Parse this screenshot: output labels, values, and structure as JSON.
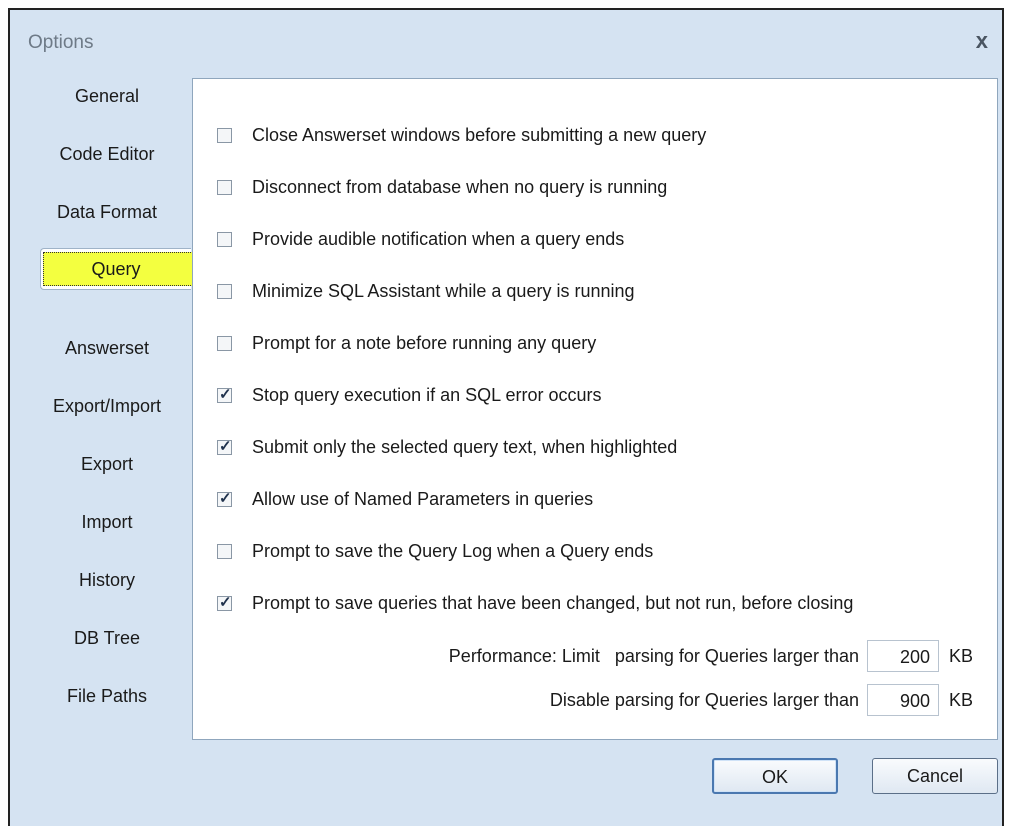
{
  "window": {
    "title": "Options",
    "close_glyph": "x"
  },
  "tabs": [
    {
      "id": "general",
      "label": "General",
      "active": false
    },
    {
      "id": "code-editor",
      "label": "Code Editor",
      "active": false
    },
    {
      "id": "data-format",
      "label": "Data Format",
      "active": false
    },
    {
      "id": "query",
      "label": "Query",
      "active": true,
      "highlight_color": "#f3ff40"
    },
    {
      "id": "answerset",
      "label": "Answerset",
      "active": false
    },
    {
      "id": "export-import",
      "label": "Export/Import",
      "active": false
    },
    {
      "id": "export",
      "label": "Export",
      "active": false
    },
    {
      "id": "import",
      "label": "Import",
      "active": false
    },
    {
      "id": "history",
      "label": "History",
      "active": false
    },
    {
      "id": "db-tree",
      "label": "DB Tree",
      "active": false
    },
    {
      "id": "file-paths",
      "label": "File Paths",
      "active": false
    }
  ],
  "options": [
    {
      "label": "Close Answerset windows before submitting a new query",
      "checked": false
    },
    {
      "label": "Disconnect from database when no query is running",
      "checked": false
    },
    {
      "label": "Provide audible notification when a query ends",
      "checked": false
    },
    {
      "label": "Minimize SQL Assistant while a query is running",
      "checked": false
    },
    {
      "label": "Prompt for a note before running any query",
      "checked": false
    },
    {
      "label": "Stop query execution if an SQL error occurs",
      "checked": true
    },
    {
      "label": "Submit only the selected query text, when highlighted",
      "checked": true
    },
    {
      "label": "Allow use of Named Parameters in queries",
      "checked": true
    },
    {
      "label": "Prompt to save the Query Log when a Query ends",
      "checked": false
    },
    {
      "label": "Prompt to save queries that have been changed, but not run, before closing",
      "checked": true
    }
  ],
  "performance": {
    "limit_label": "Performance: Limit   parsing for Queries larger than",
    "limit_value": "200",
    "disable_label": "Disable parsing for Queries larger than",
    "disable_value": "900",
    "unit": "KB"
  },
  "buttons": {
    "ok": "OK",
    "cancel": "Cancel"
  }
}
